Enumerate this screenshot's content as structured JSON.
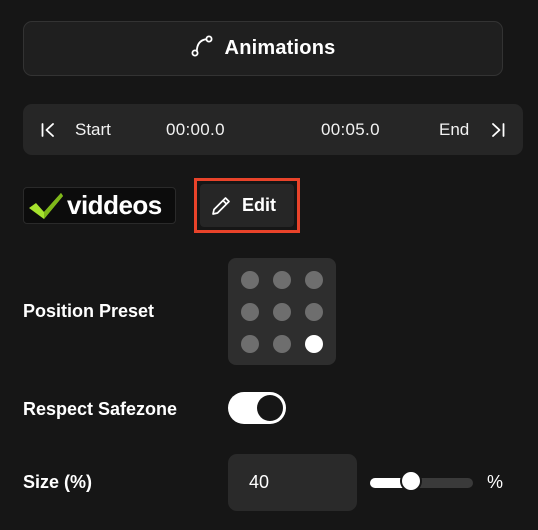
{
  "animations": {
    "label": "Animations",
    "icon": "path-curve-icon"
  },
  "timeline": {
    "start_label": "Start",
    "start_time": "00:00.0",
    "end_time": "00:05.0",
    "end_label": "End"
  },
  "logo": {
    "text": "viddeos",
    "accent_color": "#a6e22e"
  },
  "edit": {
    "label": "Edit",
    "icon": "pencil-icon"
  },
  "position_preset": {
    "label": "Position Preset",
    "selected_index": 8,
    "count": 9
  },
  "safezone": {
    "label": "Respect Safezone",
    "enabled": true
  },
  "size": {
    "label": "Size (%)",
    "value": "40",
    "slider_fraction": 0.4,
    "unit": "%"
  },
  "colors": {
    "background": "#161616",
    "highlight_border": "#e8432a"
  }
}
